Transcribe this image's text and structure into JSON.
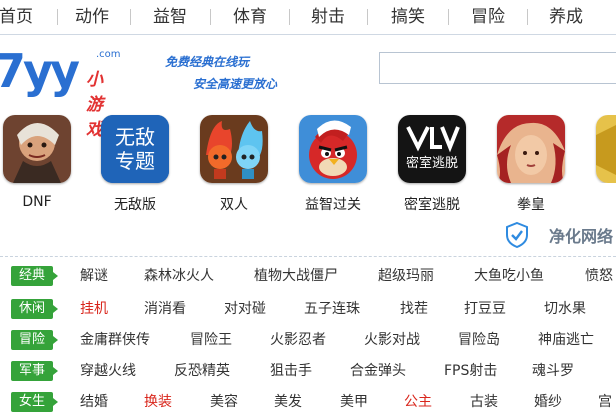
{
  "nav": [
    "首页",
    "动作",
    "益智",
    "体育",
    "射击",
    "搞笑",
    "冒险",
    "养成"
  ],
  "logo": {
    "main": "7yy",
    "domain": ".com",
    "suffix": "小游戏"
  },
  "slogan": {
    "line1": "免费经典在线玩",
    "line2": "安全高速更放心"
  },
  "games": [
    {
      "label": "DNF",
      "icon": "dnf-warrior-icon",
      "color": "#7a4a36"
    },
    {
      "label": "无敌版",
      "icon": "invincible-topic-icon",
      "text": "无敌\n专题",
      "color": "#1f64b8"
    },
    {
      "label": "双人",
      "icon": "fire-water-icon",
      "color": "#c5302a"
    },
    {
      "label": "益智过关",
      "icon": "angry-bird-icon",
      "color": "#3f8ed8"
    },
    {
      "label": "密室逃脱",
      "icon": "escape-room-icon",
      "text": "密室逃脱",
      "color": "#111111"
    },
    {
      "label": "拳皇",
      "icon": "kof-fighter-icon",
      "color": "#b52a2a"
    }
  ],
  "badge": {
    "text": "净化网络"
  },
  "categories": [
    {
      "tag": "经典",
      "items": [
        {
          "text": "解谜",
          "hot": false
        },
        {
          "text": "森林冰火人",
          "hot": false
        },
        {
          "text": "植物大战僵尸",
          "hot": false
        },
        {
          "text": "超级玛丽",
          "hot": false
        },
        {
          "text": "大鱼吃小鱼",
          "hot": false
        },
        {
          "text": "愤怒",
          "hot": false
        }
      ]
    },
    {
      "tag": "休闲",
      "items": [
        {
          "text": "挂机",
          "hot": true
        },
        {
          "text": "消消看",
          "hot": false
        },
        {
          "text": "对对碰",
          "hot": false
        },
        {
          "text": "五子连珠",
          "hot": false
        },
        {
          "text": "找茬",
          "hot": false
        },
        {
          "text": "打豆豆",
          "hot": false
        },
        {
          "text": "切水果",
          "hot": false
        }
      ]
    },
    {
      "tag": "冒险",
      "items": [
        {
          "text": "金庸群侠传",
          "hot": false
        },
        {
          "text": "冒险王",
          "hot": false
        },
        {
          "text": "火影忍者",
          "hot": false
        },
        {
          "text": "火影对战",
          "hot": false
        },
        {
          "text": "冒险岛",
          "hot": false
        },
        {
          "text": "神庙逃亡",
          "hot": false
        }
      ]
    },
    {
      "tag": "军事",
      "items": [
        {
          "text": "穿越火线",
          "hot": false
        },
        {
          "text": "反恐精英",
          "hot": false
        },
        {
          "text": "狙击手",
          "hot": false
        },
        {
          "text": "合金弹头",
          "hot": false
        },
        {
          "text": "FPS射击",
          "hot": false
        },
        {
          "text": "魂斗罗",
          "hot": false
        }
      ]
    },
    {
      "tag": "女生",
      "items": [
        {
          "text": "结婚",
          "hot": false
        },
        {
          "text": "换装",
          "hot": true
        },
        {
          "text": "美容",
          "hot": false
        },
        {
          "text": "美发",
          "hot": false
        },
        {
          "text": "美甲",
          "hot": false
        },
        {
          "text": "公主",
          "hot": true
        },
        {
          "text": "古装",
          "hot": false
        },
        {
          "text": "婚纱",
          "hot": false
        },
        {
          "text": "宫",
          "hot": false
        }
      ]
    }
  ]
}
